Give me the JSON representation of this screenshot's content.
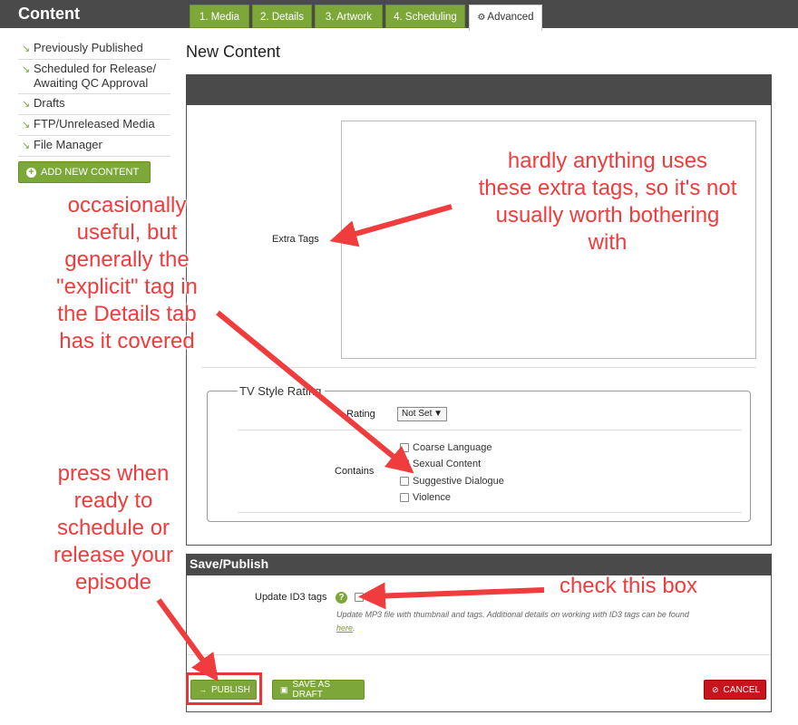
{
  "app": {
    "title": "Content"
  },
  "sidebar": {
    "items": [
      {
        "label": "Previously Published"
      },
      {
        "label": "Scheduled for Release/\nAwaiting QC Approval"
      },
      {
        "label": "Drafts"
      },
      {
        "label": "FTP/Unreleased Media"
      },
      {
        "label": "File Manager"
      }
    ],
    "add_button": "ADD NEW CONTENT"
  },
  "main": {
    "title": "New Content",
    "tabs": [
      {
        "label": "1. Media"
      },
      {
        "label": "2. Details"
      },
      {
        "label": "3. Artwork"
      },
      {
        "label": "4. Scheduling"
      },
      {
        "label": "Advanced",
        "active": true
      }
    ],
    "extra_tags_label": "Extra Tags",
    "tv_rating": {
      "legend": "TV Style Rating",
      "rating_label": "Rating",
      "rating_value": "Not Set",
      "contains_label": "Contains",
      "options": [
        "Coarse Language",
        "Sexual Content",
        "Suggestive Dialogue",
        "Violence"
      ]
    }
  },
  "save": {
    "header": "Save/Publish",
    "id3_label": "Update ID3 tags",
    "id3_help": "?",
    "id3_desc": "Update MP3 file with thumbnail and tags. Additional details on working with ID3 tags can be found",
    "id3_link": "here",
    "publish": "PUBLISH",
    "draft": "SAVE AS DRAFT",
    "cancel": "CANCEL"
  },
  "annotations": {
    "tags_note": "hardly anything uses\nthese extra tags, so it's not\nusually worth bothering\nwith",
    "explicit_note": "occasionally\nuseful, but\ngenerally the\n\"explicit\" tag in\nthe Details tab\nhas it covered",
    "publish_note": "press when\nready to\nschedule or\nrelease your\nepisode",
    "check_note": "check this box"
  },
  "colors": {
    "accent": "#7ea739",
    "danger": "#c8141c",
    "annotation": "#f03c3c",
    "header": "#4a4a4a"
  }
}
